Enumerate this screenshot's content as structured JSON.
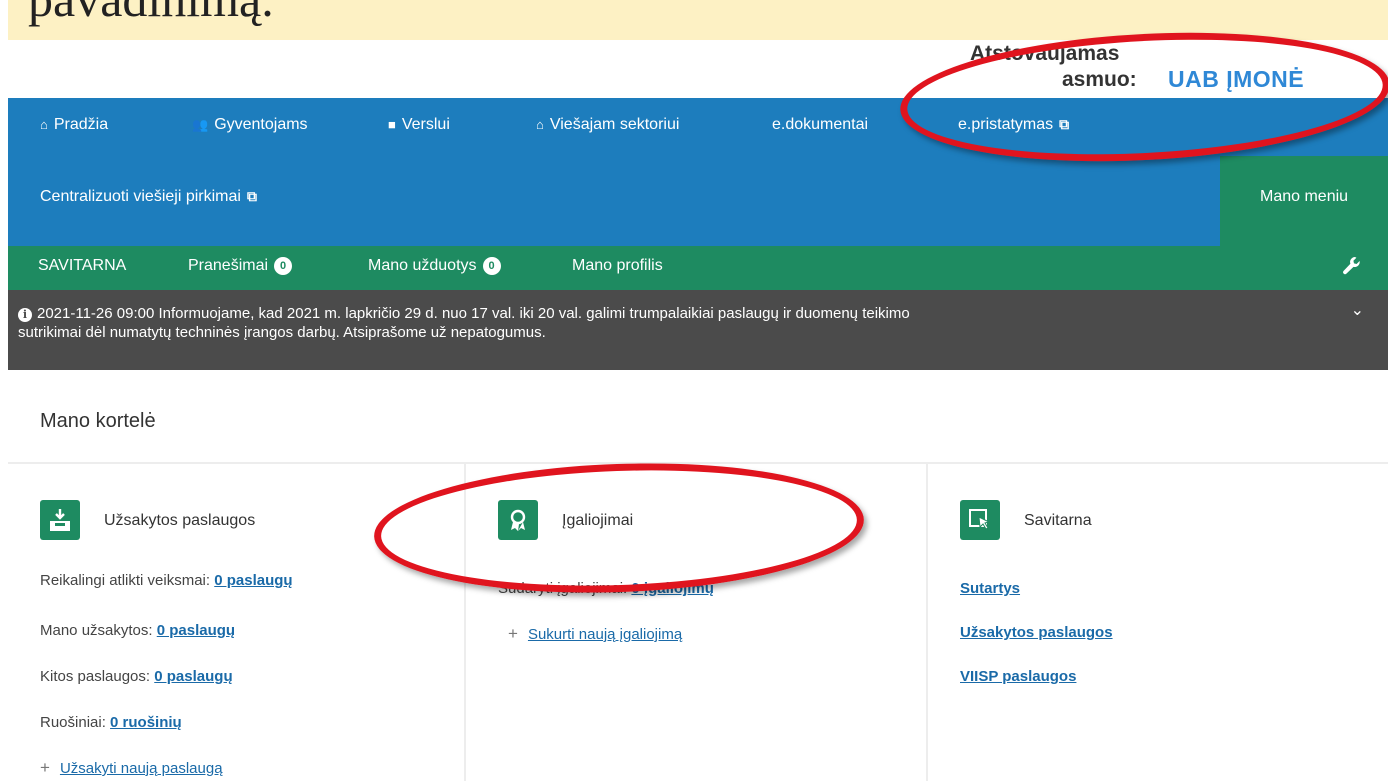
{
  "caption": {
    "text": "pavadinimą."
  },
  "represent": {
    "label_line1": "Atstovaujamas",
    "label_line2": "asmuo:",
    "company": "UAB ĮMONĖ"
  },
  "top_nav": [
    {
      "label": "Pradžia",
      "icon": "home-icon"
    },
    {
      "label": "Gyventojams",
      "icon": "people-icon"
    },
    {
      "label": "Verslui",
      "icon": "briefcase-icon"
    },
    {
      "label": "Viešajam sektoriui",
      "icon": "institution-icon"
    },
    {
      "label": "e.dokumentai"
    },
    {
      "label": "e.pristatymas",
      "icon": "external-link-icon"
    }
  ],
  "second_nav": {
    "label": "Centralizuoti viešieji pirkimai",
    "icon": "external-link-icon",
    "menu": "Mano meniu"
  },
  "green_nav": {
    "savitarna": "SAVITARNA",
    "notifications": {
      "label": "Pranešimai",
      "count": "0"
    },
    "tasks": {
      "label": "Mano užduotys",
      "count": "0"
    },
    "profile": "Mano profilis"
  },
  "banner": {
    "text_line1": "2021-11-26 09:00  Informuojame, kad 2021 m. lapkričio 29 d. nuo 17 val. iki 20 val. galimi trumpalaikiai paslaugų ir duomenų teikimo",
    "text_line2": "sutrikimai dėl numatytų techninės įrangos darbų. Atsiprašome už nepatogumus."
  },
  "page_title": "Mano kortelė",
  "cards": {
    "ordered": {
      "title": "Užsakytos paslaugos",
      "rows": [
        {
          "label": "Reikalingi atlikti veiksmai:",
          "value": "0 paslaugų"
        },
        {
          "label": "Mano užsakytos:",
          "value": "0 paslaugų"
        },
        {
          "label": "Kitos paslaugos:",
          "value": "0 paslaugų"
        },
        {
          "label": "Ruošiniai:",
          "value": "0 ruošinių"
        }
      ],
      "add_label": "Užsakyti naują paslaugą"
    },
    "authorizations": {
      "title": "Įgaliojimai",
      "row_label": "Sudaryti įgaliojimai:",
      "row_value": "0 įgaliojimų",
      "add_label": "Sukurti naują įgaliojimą"
    },
    "selfservice": {
      "title": "Savitarna",
      "links": [
        "Sutartys",
        "Užsakytos paslaugos",
        "VIISP paslaugos"
      ]
    }
  },
  "colors": {
    "blue_nav": "#1d7dbd",
    "green_nav": "#1e8b61",
    "banner": "#4b4b4b",
    "link": "#1a6aa8",
    "annotation": "#e0141e"
  }
}
